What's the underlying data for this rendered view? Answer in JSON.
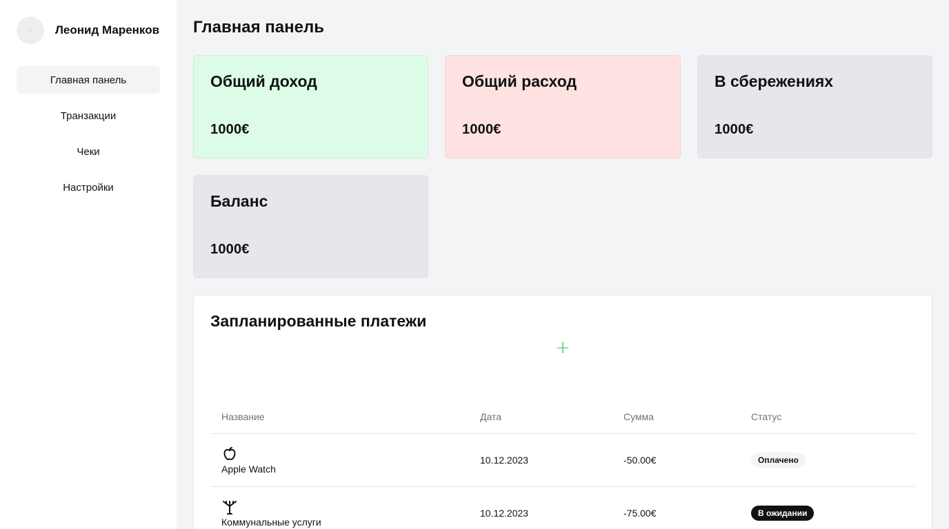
{
  "sidebar": {
    "user_name": "Леонид Маренков",
    "nav": [
      {
        "label": "Главная панель",
        "active": true
      },
      {
        "label": "Транзакции",
        "active": false
      },
      {
        "label": "Чеки",
        "active": false
      },
      {
        "label": "Настройки",
        "active": false
      }
    ]
  },
  "header": {
    "title": "Главная панель"
  },
  "cards": [
    {
      "title": "Общий доход",
      "value": "1000€",
      "color": "#dcfce7"
    },
    {
      "title": "Общий расход",
      "value": "1000€",
      "color": "#fee2e2"
    },
    {
      "title": "В сбережениях",
      "value": "1000€",
      "color": "#e5e7eb"
    },
    {
      "title": "Баланс",
      "value": "1000€",
      "color": "#e5e7eb"
    }
  ],
  "payments": {
    "title": "Запланированные платежи",
    "add_icon": "+",
    "add_color": "#22c55e",
    "columns": [
      "Название",
      "Дата",
      "Сумма",
      "Статус"
    ],
    "rows": [
      {
        "icon": "apple-icon",
        "name": "Apple Watch",
        "date": "10.12.2023",
        "amount": "-50.00€",
        "status": "Оплачено"
      },
      {
        "icon": "utility-tower-icon",
        "name": "Коммунальные услуги",
        "date": "10.12.2023",
        "amount": "-75.00€",
        "status": "В ожидании"
      }
    ]
  }
}
